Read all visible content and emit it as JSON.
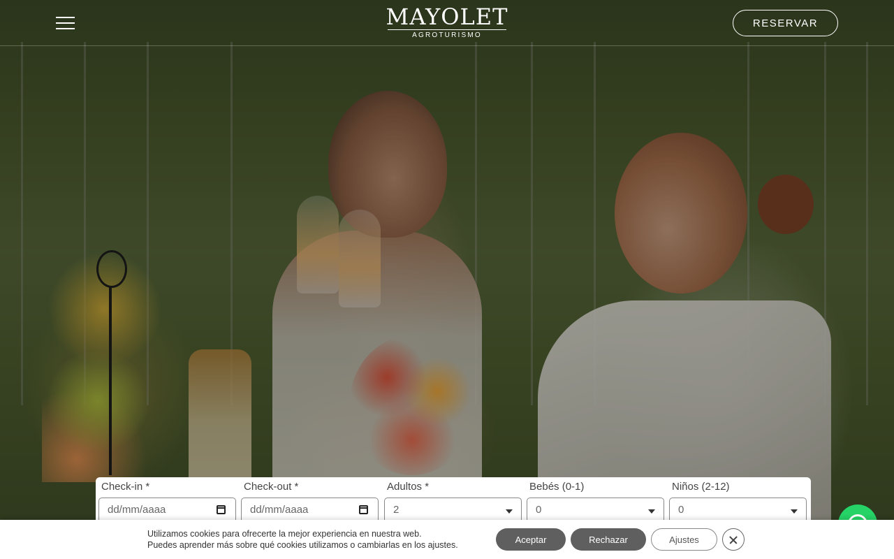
{
  "header": {
    "logo_name": "MAYOLET",
    "logo_sub": "AGROTURISMO",
    "reserve_label": "RESERVAR"
  },
  "booking": {
    "checkin": {
      "label": "Check-in *",
      "placeholder": "dd/mm/aaaa"
    },
    "checkout": {
      "label": "Check-out *",
      "placeholder": "dd/mm/aaaa"
    },
    "adults": {
      "label": "Adultos *",
      "value": "2"
    },
    "babies": {
      "label": "Bebés (0-1)",
      "value": "0"
    },
    "children": {
      "label": "Niños (2-12)",
      "value": "0"
    }
  },
  "cookie": {
    "line1": "Utilizamos cookies para ofrecerte la mejor experiencia en nuestra web.",
    "line2": "Puedes aprender más sobre qué cookies utilizamos o cambiarlas en los ajustes.",
    "accept_label": "Aceptar",
    "reject_label": "Rechazar",
    "settings_label": "Ajustes"
  },
  "colors": {
    "whatsapp": "#25d366",
    "cookie_button": "#5f5f5f"
  },
  "icons": [
    "hamburger-menu-icon",
    "calendar-icon",
    "chevron-down-icon",
    "whatsapp-icon",
    "close-icon"
  ]
}
